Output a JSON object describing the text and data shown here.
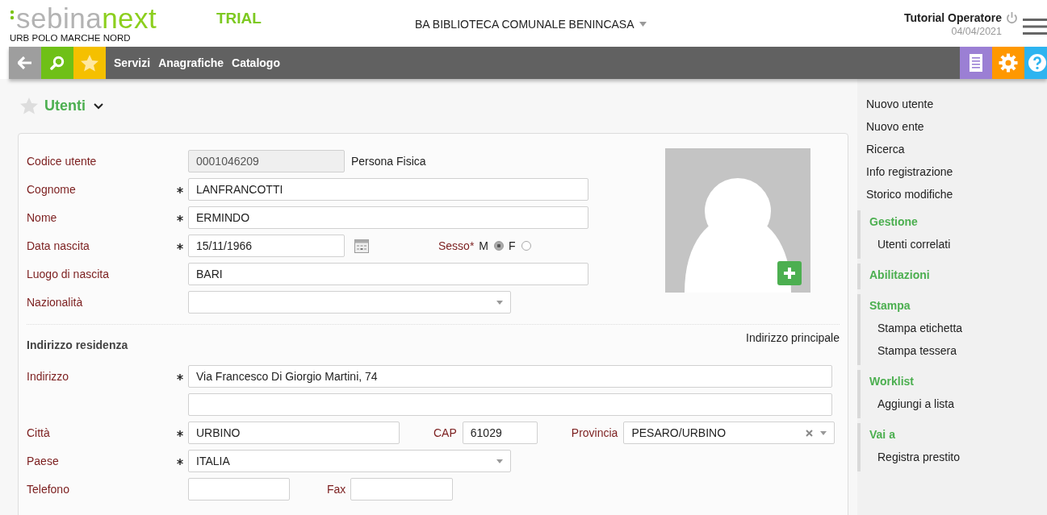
{
  "header": {
    "logo": [
      "sebina",
      "next"
    ],
    "trial": "TRIAL",
    "org": "URB POLO MARCHE NORD",
    "library": "BA BIBLIOTECA COMUNALE BENINCASA",
    "user": "Tutorial Operatore",
    "date": "04/04/2021"
  },
  "toolbar": {
    "menu": [
      "Servizi",
      "Anagrafiche",
      "Catalogo"
    ]
  },
  "page": {
    "title": "Utenti",
    "favorite": false
  },
  "personal": [
    {
      "kind": "readonly",
      "label": "Codice utente",
      "required": false,
      "value": "0001046209",
      "note": "Persona Fisica"
    },
    {
      "kind": "text",
      "label": "Cognome",
      "required": true,
      "value": "LANFRANCOTTI"
    },
    {
      "kind": "text",
      "label": "Nome",
      "required": true,
      "value": "ERMINDO"
    },
    {
      "kind": "date",
      "label": "Data nascita",
      "required": true,
      "value": "15/11/1966",
      "sex": {
        "label": "Sesso*",
        "options": [
          {
            "label": "M",
            "selected": true
          },
          {
            "label": "F",
            "selected": false
          }
        ]
      }
    },
    {
      "kind": "text",
      "label": "Luogo di nascita",
      "required": false,
      "value": "BARI"
    },
    {
      "kind": "select",
      "label": "Nazionalità",
      "required": false
    }
  ],
  "address": {
    "title": "Indirizzo residenza",
    "type": "Indirizzo principale",
    "rows": [
      {
        "kind": "address",
        "label": "Indirizzo",
        "required": true,
        "value": "Via Francesco Di Giorgio Martini, 74"
      },
      {
        "kind": "address",
        "required": false
      },
      {
        "kind": "city",
        "label": "Città",
        "required": true,
        "value": "URBINO",
        "extras": [
          {
            "label": "CAP",
            "kind": "text",
            "value": "61029"
          },
          {
            "label": "Provincia",
            "kind": "select",
            "value": "PESARO/URBINO",
            "clearable": true
          }
        ]
      },
      {
        "kind": "select",
        "label": "Paese",
        "required": true,
        "value": "ITALIA"
      },
      {
        "kind": "phone",
        "label": "Telefono",
        "required": false,
        "extras": [
          {
            "label": "Fax",
            "kind": "text"
          }
        ]
      }
    ]
  },
  "sidebar": {
    "actions": [
      "Nuovo utente",
      "Nuovo ente",
      "Ricerca",
      "Info registrazione",
      "Storico modifiche"
    ],
    "groups": [
      {
        "title": "Gestione",
        "items": [
          "Utenti correlati"
        ]
      },
      {
        "title": "Abilitazioni"
      },
      {
        "title": "Stampa",
        "items": [
          "Stampa etichetta",
          "Stampa tessera"
        ]
      },
      {
        "title": "Worklist",
        "items": [
          "Aggiungi a lista"
        ]
      },
      {
        "title": "Vai a",
        "items": [
          "Registra prestito"
        ]
      }
    ]
  }
}
